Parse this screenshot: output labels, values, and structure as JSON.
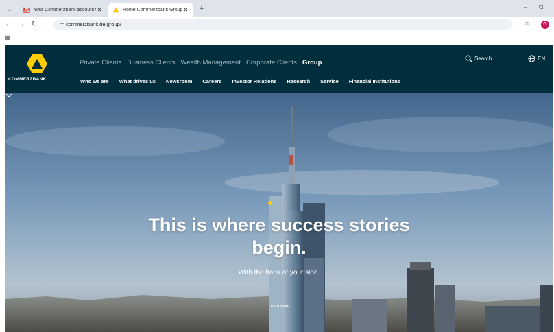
{
  "browser": {
    "tabs": [
      {
        "title": "Your Commerzbank account w",
        "active": false,
        "favicon": "gmail-icon"
      },
      {
        "title": "Home Commerzbank Group - C",
        "active": true,
        "favicon": "commerzbank-icon"
      }
    ],
    "url": "commerzbank.de/group/",
    "profile_initial": "G"
  },
  "header": {
    "brand": "COMMERZBANK",
    "segments": [
      "Private Clients",
      "Business Clients",
      "Wealth Management",
      "Corporate Clients",
      "Group"
    ],
    "active_segment": "Group",
    "search_label": "Search",
    "language": "EN",
    "subnav": [
      "Who we are",
      "What drives us",
      "Newsroom",
      "Careers",
      "Investor Relations",
      "Research",
      "Service",
      "Financial Institutions"
    ]
  },
  "hero": {
    "title_line1": "This is where success stories",
    "title_line2": "begin.",
    "subtitle": "With the bank at your side.",
    "learn_more": "Learn more"
  },
  "colors": {
    "brand_dark": "#002e3c",
    "brand_yellow": "#ffcc00",
    "inactive_nav": "#9ab3bd",
    "tab_strip": "#dfe4ec"
  }
}
